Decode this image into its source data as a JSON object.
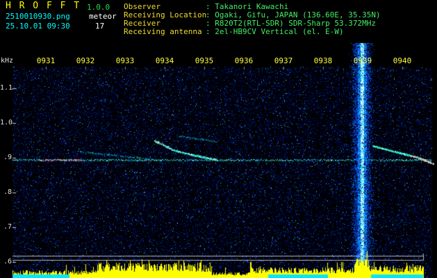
{
  "app": {
    "title": "H R O F F T",
    "version": "1.0.0",
    "filename": "2510010930.png",
    "mode": "meteor",
    "datetime": "25.10.01 09:30",
    "count": "17"
  },
  "info": {
    "rows": [
      {
        "label": "Observer",
        "value": ": Takanori Kawachi"
      },
      {
        "label": "Receiving Location",
        "value": ": Ogaki, Gifu, JAPAN (136.60E, 35.35N)"
      },
      {
        "label": "Receiver",
        "value": ": R820T2(RTL-SDR) SDR-Sharp 53.372MHz"
      },
      {
        "label": "Receiving antenna",
        "value": ": 2el-HB9CV Vertical (el. E-W)"
      }
    ]
  },
  "chart_data": {
    "type": "heatmap",
    "title": "",
    "xlabel": "",
    "ylabel": "kHz",
    "x_ticks": [
      "0931",
      "0932",
      "0933",
      "0934",
      "0935",
      "0936",
      "0937",
      "0938",
      "0939",
      "0940"
    ],
    "y_ticks": [
      "1.1",
      "1.0",
      ".9",
      ".8",
      ".7",
      ".6"
    ],
    "y_tick_values_khz": [
      1.1,
      1.0,
      0.9,
      0.8,
      0.7,
      0.6
    ],
    "ylim_khz": [
      0.55,
      1.17
    ],
    "grid": false,
    "features": {
      "carrier_trace_khz": 0.9,
      "meteor_echo_count_shown": 17,
      "echo_traces": [
        {
          "time": "0931.8-0933.9",
          "freq_khz_start": 0.92,
          "freq_khz_end": 0.9,
          "intensity": "faint"
        },
        {
          "time": "0933.7-0935.3",
          "freq_khz_start": 0.95,
          "freq_khz_end": 0.9,
          "intensity": "bright"
        },
        {
          "time": "0934.4-0935.3",
          "freq_khz_start": 0.97,
          "freq_khz_end": 0.95,
          "intensity": "faint"
        },
        {
          "time": "0939.2-0940.8",
          "freq_khz_start": 0.93,
          "freq_khz_end": 0.88,
          "intensity": "moderate, reddening toward end"
        }
      ],
      "broadband_event": {
        "time": "0939.0",
        "freq_span_khz": [
          0.55,
          1.17
        ],
        "description": "saturated vertical echo column"
      },
      "level_graph": {
        "description": "bottom signal-level bars with detection segments"
      }
    }
  },
  "colors": {
    "background": "#000000",
    "title_yellow": "#ffff00",
    "version_green": "#22dd44",
    "cyan_text": "#00ffff",
    "white_text": "#ffffff",
    "label_yellow": "#eedd33",
    "value_green": "#44ee66",
    "axis_text": "#e0e0e0",
    "time_text": "#ffff44",
    "bar_yellow": "#ffff00",
    "segment_cyan": "#00e6ff"
  }
}
